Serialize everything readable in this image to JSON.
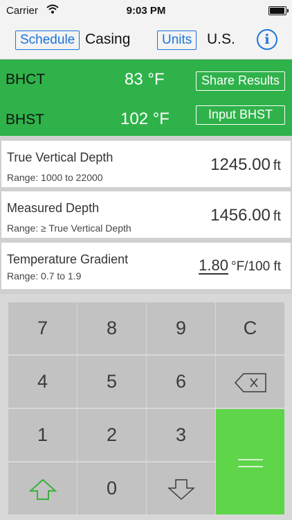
{
  "status_bar": {
    "carrier": "Carrier",
    "time": "9:03 PM"
  },
  "toolbar": {
    "schedule_label": "Schedule",
    "schedule_value": "Casing",
    "units_label": "Units",
    "units_value": "U.S.",
    "info_glyph": "i"
  },
  "results": {
    "bhct_label": "BHCT",
    "bhct_value": "83 °F",
    "bhst_label": "BHST",
    "bhst_value": "102 °F",
    "share_label": "Share Results",
    "input_bhst_label": "Input BHST"
  },
  "inputs": [
    {
      "label": "True Vertical Depth",
      "range": "Range: 1000 to 22000",
      "value": "1245.00",
      "unit": "ft"
    },
    {
      "label": "Measured Depth",
      "range": "Range: ≥ True Vertical Depth",
      "value": "1456.00",
      "unit": "ft"
    },
    {
      "label": "Temperature  Gradient",
      "range": "Range: 0.7 to 1.9",
      "value": "1.80",
      "unit": "°F/100 ft"
    }
  ],
  "keypad": {
    "k7": "7",
    "k8": "8",
    "k9": "9",
    "clear": "C",
    "k4": "4",
    "k5": "5",
    "k6": "6",
    "backspace_icon": "backspace-icon",
    "k1": "1",
    "k2": "2",
    "k3": "3",
    "equals": "=",
    "up_icon": "arrow-up-icon",
    "k0": "0",
    "down_icon": "arrow-down-icon"
  },
  "colors": {
    "accent_blue": "#1a73d9",
    "results_green": "#2fb24a",
    "equals_green": "#5fd54a",
    "key_gray": "#c2c2c2",
    "up_arrow_green": "#3bb03b"
  }
}
